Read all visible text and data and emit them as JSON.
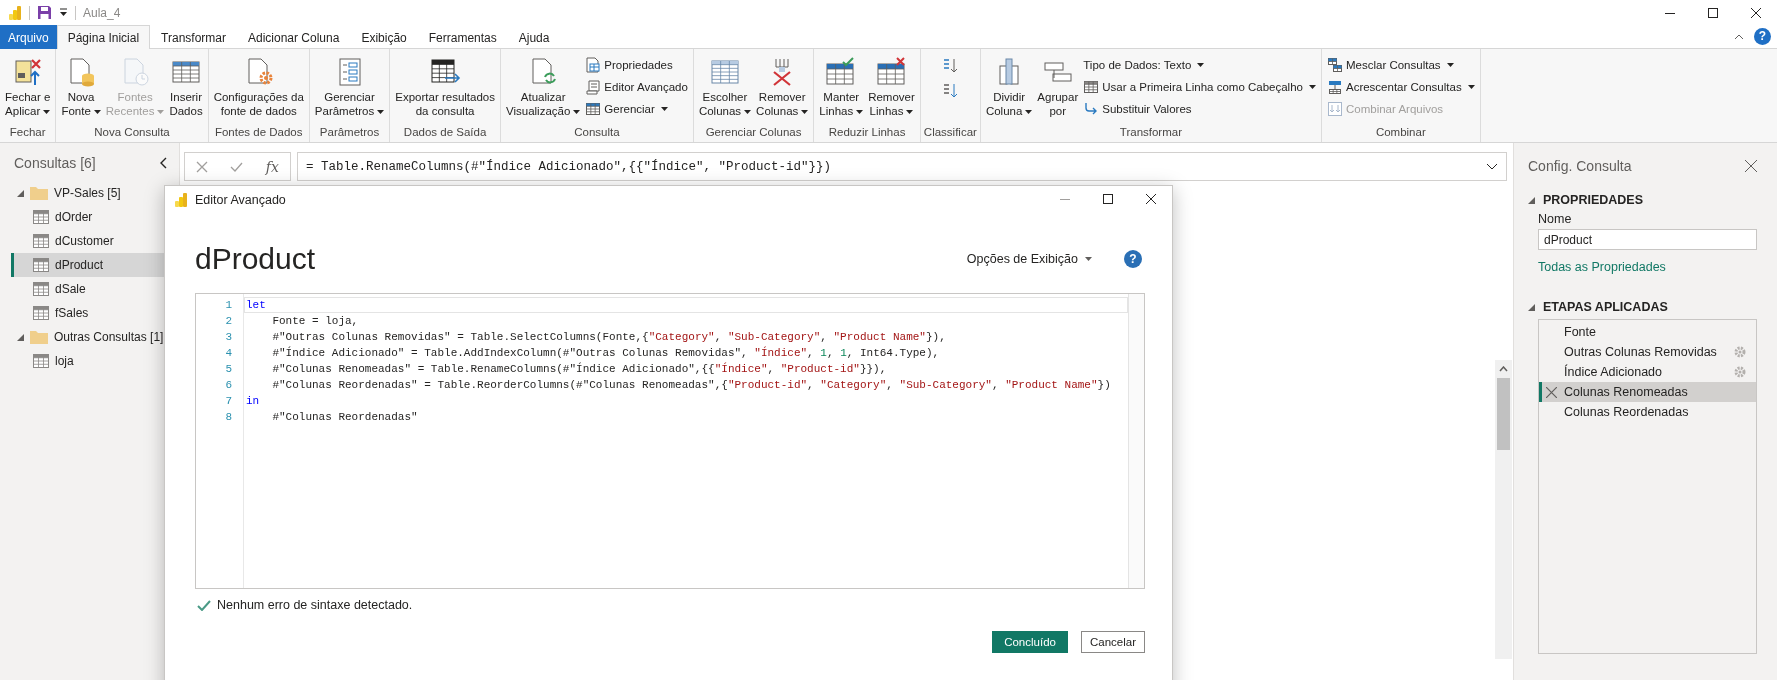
{
  "app_title": "Aula_4",
  "tabs": [
    {
      "label": "Arquivo",
      "kind": "file",
      "selected": false
    },
    {
      "label": "Página Inicial",
      "kind": "tab",
      "selected": true
    },
    {
      "label": "Transformar",
      "kind": "tab",
      "selected": false
    },
    {
      "label": "Adicionar Coluna",
      "kind": "tab",
      "selected": false
    },
    {
      "label": "Exibição",
      "kind": "tab",
      "selected": false
    },
    {
      "label": "Ferramentas",
      "kind": "tab",
      "selected": false
    },
    {
      "label": "Ajuda",
      "kind": "tab",
      "selected": false
    }
  ],
  "help": "?",
  "ribbon": {
    "groups": [
      {
        "label": "Fechar",
        "items": [
          {
            "kind": "large",
            "lines": [
              "Fechar e",
              "Aplicar"
            ],
            "dropdown": true,
            "disabled": false
          }
        ]
      },
      {
        "label": "Nova Consulta",
        "items": [
          {
            "kind": "large",
            "lines": [
              "Nova",
              "Fonte"
            ],
            "dropdown": true,
            "disabled": false
          },
          {
            "kind": "large",
            "lines": [
              "Fontes",
              "Recentes"
            ],
            "dropdown": true,
            "disabled": true
          },
          {
            "kind": "large",
            "lines": [
              "Inserir",
              "Dados"
            ],
            "dropdown": false,
            "disabled": false
          }
        ]
      },
      {
        "label": "Fontes de Dados",
        "items": [
          {
            "kind": "large",
            "lines": [
              "Configurações da",
              "fonte de dados"
            ],
            "dropdown": false,
            "disabled": false
          }
        ]
      },
      {
        "label": "Parâmetros",
        "items": [
          {
            "kind": "large",
            "lines": [
              "Gerenciar",
              "Parâmetros"
            ],
            "dropdown": true,
            "disabled": false
          }
        ]
      },
      {
        "label": "Dados de Saída",
        "items": [
          {
            "kind": "large",
            "lines": [
              "Exportar resultados",
              "da consulta"
            ],
            "dropdown": false,
            "disabled": false
          }
        ]
      },
      {
        "label": "Consulta",
        "items": [
          {
            "kind": "large",
            "lines": [
              "Atualizar",
              "Visualização"
            ],
            "dropdown": true,
            "disabled": false
          },
          {
            "kind": "stack",
            "items": [
              {
                "kind": "small",
                "label": "Propriedades",
                "dropdown": false,
                "disabled": false
              },
              {
                "kind": "small",
                "label": "Editor Avançado",
                "dropdown": false,
                "disabled": false
              },
              {
                "kind": "small",
                "label": "Gerenciar",
                "dropdown": true,
                "disabled": false
              }
            ]
          }
        ]
      },
      {
        "label": "Gerenciar Colunas",
        "items": [
          {
            "kind": "large",
            "lines": [
              "Escolher",
              "Colunas"
            ],
            "dropdown": true,
            "disabled": false
          },
          {
            "kind": "large",
            "lines": [
              "Remover",
              "Colunas"
            ],
            "dropdown": true,
            "disabled": false
          }
        ]
      },
      {
        "label": "Reduzir Linhas",
        "items": [
          {
            "kind": "large",
            "lines": [
              "Manter",
              "Linhas"
            ],
            "dropdown": true,
            "disabled": false
          },
          {
            "kind": "large",
            "lines": [
              "Remover",
              "Linhas"
            ],
            "dropdown": true,
            "disabled": false
          }
        ]
      },
      {
        "label": "Classificar",
        "items": [
          {
            "kind": "stack",
            "items": [
              {
                "kind": "icon",
                "disabled": false
              },
              {
                "kind": "icon",
                "disabled": false
              }
            ]
          }
        ]
      },
      {
        "label": "Transformar",
        "items": [
          {
            "kind": "large",
            "lines": [
              "Dividir",
              "Coluna"
            ],
            "dropdown": true,
            "disabled": false
          },
          {
            "kind": "large",
            "lines": [
              "Agrupar",
              "por"
            ],
            "dropdown": false,
            "disabled": false
          },
          {
            "kind": "stack",
            "items": [
              {
                "kind": "small",
                "label": "Tipo de Dados: Texto",
                "dropdown": true,
                "disabled": false
              },
              {
                "kind": "small",
                "label": "Usar a Primeira Linha como Cabeçalho",
                "dropdown": true,
                "disabled": false
              },
              {
                "kind": "small",
                "label": "Substituir Valores",
                "dropdown": false,
                "disabled": false
              }
            ]
          }
        ]
      },
      {
        "label": "Combinar",
        "items": [
          {
            "kind": "stack",
            "items": [
              {
                "kind": "small",
                "label": "Mesclar Consultas",
                "dropdown": true,
                "disabled": false
              },
              {
                "kind": "small",
                "label": "Acrescentar Consultas",
                "dropdown": true,
                "disabled": false
              },
              {
                "kind": "small",
                "label": "Combinar Arquivos",
                "dropdown": false,
                "disabled": true
              }
            ]
          }
        ]
      }
    ]
  },
  "queries_panel": {
    "title": "Consultas [6]",
    "tree": [
      {
        "label": "VP-Sales [5]",
        "expanded": true,
        "children": [
          {
            "label": "dOrder",
            "selected": false
          },
          {
            "label": "dCustomer",
            "selected": false
          },
          {
            "label": "dProduct",
            "selected": true
          },
          {
            "label": "dSale",
            "selected": false
          },
          {
            "label": "fSales",
            "selected": false
          }
        ]
      },
      {
        "label": "Outras Consultas [1]",
        "expanded": true,
        "children": [
          {
            "label": "loja",
            "selected": false
          }
        ]
      }
    ]
  },
  "formula_bar": {
    "fx": "fx",
    "formula": "= Table.RenameColumns(#\"Índice Adicionado\",{{\"Índice\", \"Product-id\"}})"
  },
  "query_settings": {
    "title": "Config. Consulta",
    "properties": {
      "heading": "PROPRIEDADES",
      "expanded": true,
      "name_label": "Nome",
      "name_value": "dProduct",
      "link": "Todas as Propriedades"
    },
    "steps": {
      "heading": "ETAPAS APLICADAS",
      "expanded": true,
      "items": [
        {
          "label": "Fonte",
          "settings": false,
          "selected": false
        },
        {
          "label": "Outras Colunas Removidas",
          "settings": true,
          "selected": false
        },
        {
          "label": "Índice Adicionado",
          "settings": true,
          "selected": false
        },
        {
          "label": "Colunas Renomeadas",
          "settings": false,
          "selected": true
        },
        {
          "label": "Colunas Reordenadas",
          "settings": false,
          "selected": false
        }
      ]
    }
  },
  "advanced_editor": {
    "window_title": "Editor Avançado",
    "query_name": "dProduct",
    "display_options": "Opções de Exibição",
    "help": "?",
    "lines": [
      {
        "number": "1",
        "current": true,
        "tokens": [
          {
            "kind": "keyword",
            "text": "let"
          }
        ]
      },
      {
        "number": "2",
        "current": false,
        "tokens": [
          {
            "kind": "plain",
            "text": "    Fonte = loja,"
          }
        ]
      },
      {
        "number": "3",
        "current": false,
        "tokens": [
          {
            "kind": "plain",
            "text": "    #\"Outras Colunas Removidas\" = Table.SelectColumns(Fonte,{"
          },
          {
            "kind": "string",
            "text": "\"Category\""
          },
          {
            "kind": "plain",
            "text": ", "
          },
          {
            "kind": "string",
            "text": "\"Sub-Category\""
          },
          {
            "kind": "plain",
            "text": ", "
          },
          {
            "kind": "string",
            "text": "\"Product Name\""
          },
          {
            "kind": "plain",
            "text": "}),"
          }
        ]
      },
      {
        "number": "4",
        "current": false,
        "tokens": [
          {
            "kind": "plain",
            "text": "    #\"Índice Adicionado\" = Table.AddIndexColumn(#\"Outras Colunas Removidas\", "
          },
          {
            "kind": "string",
            "text": "\"Índice\""
          },
          {
            "kind": "plain",
            "text": ", "
          },
          {
            "kind": "number",
            "text": "1"
          },
          {
            "kind": "plain",
            "text": ", "
          },
          {
            "kind": "number",
            "text": "1"
          },
          {
            "kind": "plain",
            "text": ", Int64.Type),"
          }
        ]
      },
      {
        "number": "5",
        "current": false,
        "tokens": [
          {
            "kind": "plain",
            "text": "    #\"Colunas Renomeadas\" = Table.RenameColumns(#\"Índice Adicionado\",{{"
          },
          {
            "kind": "string",
            "text": "\"Índice\""
          },
          {
            "kind": "plain",
            "text": ", "
          },
          {
            "kind": "string",
            "text": "\"Product-id\""
          },
          {
            "kind": "plain",
            "text": "}}),"
          }
        ]
      },
      {
        "number": "6",
        "current": false,
        "tokens": [
          {
            "kind": "plain",
            "text": "    #\"Colunas Reordenadas\" = Table.ReorderColumns(#\"Colunas Renomeadas\",{"
          },
          {
            "kind": "string",
            "text": "\"Product-id\""
          },
          {
            "kind": "plain",
            "text": ", "
          },
          {
            "kind": "string",
            "text": "\"Category\""
          },
          {
            "kind": "plain",
            "text": ", "
          },
          {
            "kind": "string",
            "text": "\"Sub-Category\""
          },
          {
            "kind": "plain",
            "text": ", "
          },
          {
            "kind": "string",
            "text": "\"Product Name\""
          },
          {
            "kind": "plain",
            "text": "})"
          }
        ]
      },
      {
        "number": "7",
        "current": false,
        "tokens": [
          {
            "kind": "keyword",
            "text": "in"
          }
        ]
      },
      {
        "number": "8",
        "current": false,
        "tokens": [
          {
            "kind": "plain",
            "text": "    #\"Colunas Reordenadas\""
          }
        ]
      }
    ],
    "status": "Nenhum erro de sintaxe detectado.",
    "buttons": [
      {
        "label": "Concluído",
        "kind": "primary"
      },
      {
        "label": "Cancelar",
        "kind": "secondary"
      }
    ]
  }
}
